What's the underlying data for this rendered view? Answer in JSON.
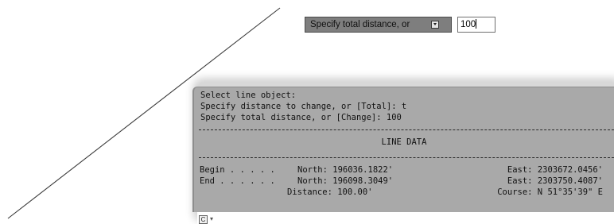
{
  "dynamic_input": {
    "prompt_label": "Specify total distance, or",
    "arrow_icon": "down-arrow-icon",
    "value": "100"
  },
  "command_window": {
    "history": [
      "Select line object:",
      "Specify distance to change, or [Total]: t",
      "Specify total distance, or [Change]: 100"
    ],
    "line_data_title": "LINE DATA",
    "begin": {
      "label": "Begin . . . . .",
      "north": "North: 196036.1822'",
      "east": "East: 2303672.0456'"
    },
    "end": {
      "label": "End . . . . . .",
      "north": "North: 196098.3049'",
      "east": "East: 2303750.4087'"
    },
    "distance": "Distance: 100.00'",
    "course": "Course: N 51°35'39\" E",
    "customize_button_label": "C",
    "dropdown_icon": "chevron-down-icon"
  },
  "colors": {
    "command_bg": "#a9a9a9",
    "prompt_bg": "#7e7e7e",
    "line_color": "#3a3a3a"
  }
}
